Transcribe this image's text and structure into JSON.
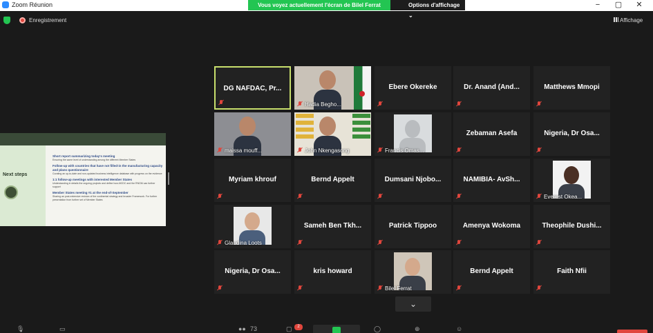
{
  "window": {
    "title": "Zoom Réunion",
    "controls": [
      "−",
      "▢",
      "✕"
    ]
  },
  "share_banner": {
    "message": "Vous voyez actuellement l'écran de Bilel Ferrat",
    "options_label": "Options d'affichage ⌄"
  },
  "top": {
    "recording_label": "Enregistrement",
    "view_label": "Affichage"
  },
  "slide": {
    "side_title": "Next steps",
    "items": [
      {
        "heading": "Short report summarizing today's meeting",
        "body": "Ensuring the same level of understanding among the different Member States"
      },
      {
        "heading": "Follow-up with countries that have not filled-in the manufacturing capacity and plans questionnaire",
        "body": "Curating an up-to-date and non-updated business intelligence database with progress on the evidence"
      },
      {
        "heading": "1:1 follow-up meetings with interested Member States",
        "body": "Understanding in details the ongoing projects and define how AfCDC and the RNGM can further support"
      },
      {
        "heading": "Member States meeting #1 at the end-of-September",
        "body": "Sharing an post-extensive revision of the continental strategy and broader Framework. For further presentation from further set of Member States"
      }
    ]
  },
  "participants": [
    {
      "name": "DG NAFDAC, Pr...",
      "type": "name",
      "active": true
    },
    {
      "name": "Hadia Begho...",
      "type": "video"
    },
    {
      "name": "Ebere Okereke",
      "type": "name"
    },
    {
      "name": "Dr. Anand (And...",
      "type": "name"
    },
    {
      "name": "Matthews Mmopi",
      "type": "name"
    },
    {
      "name": "maissa mouff...",
      "type": "video"
    },
    {
      "name": "John Nkengasong",
      "type": "video"
    },
    {
      "name": "Francis Omas...",
      "type": "photo"
    },
    {
      "name": "Zebaman Asefa",
      "type": "name"
    },
    {
      "name": "Nigeria, Dr Osa...",
      "type": "name"
    },
    {
      "name": "Myriam khrouf",
      "type": "name"
    },
    {
      "name": "Bernd Appelt",
      "type": "name"
    },
    {
      "name": "Dumsani Njobo...",
      "type": "name"
    },
    {
      "name": "NAMIBIA- AvSh...",
      "type": "name"
    },
    {
      "name": "Everest Okea...",
      "type": "photo"
    },
    {
      "name": "Glaudina Loots",
      "type": "photo"
    },
    {
      "name": "Sameh Ben Tkh...",
      "type": "name"
    },
    {
      "name": "Patrick Tippoo",
      "type": "name"
    },
    {
      "name": "Amenya Wokoma",
      "type": "name"
    },
    {
      "name": "Theophile Dushi...",
      "type": "name"
    },
    {
      "name": "Nigeria, Dr Osa...",
      "type": "name"
    },
    {
      "name": "kris howard",
      "type": "name"
    },
    {
      "name": "Bilel Ferrat",
      "type": "photo"
    },
    {
      "name": "Bernd Appelt",
      "type": "name"
    },
    {
      "name": "Faith Nfii",
      "type": "name"
    }
  ],
  "toolbar": {
    "participant_count": "73",
    "chat_badge": "2"
  },
  "colors": {
    "accent_green": "#23c552",
    "active_border": "#c9e06d",
    "mute_red": "#e0463d",
    "tile_bg": "#222222"
  }
}
